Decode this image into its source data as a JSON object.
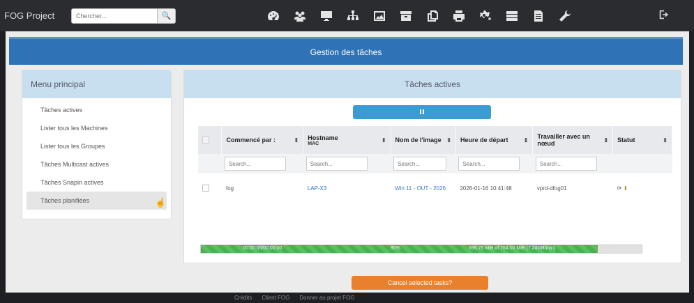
{
  "navbar": {
    "brand": "FOG Project",
    "search_placeholder": "Chercher...",
    "icons": [
      "dashboard-icon",
      "users-icon",
      "monitor-icon",
      "network-icon",
      "image-icon",
      "archive-icon",
      "copy-icon",
      "printer-icon",
      "settings-icon",
      "storage-icon",
      "document-icon",
      "wrench-icon"
    ]
  },
  "page": {
    "title": "Gestion des tâches"
  },
  "sidebar": {
    "title": "Menu principal",
    "items": [
      {
        "label": "Tâches actives"
      },
      {
        "label": "Lister tous les Machines"
      },
      {
        "label": "Lister tous les Groupes"
      },
      {
        "label": "Tâches Multicast actives"
      },
      {
        "label": "Tâches Snapin actives"
      },
      {
        "label": "Tâches planifiées"
      }
    ]
  },
  "panel": {
    "title": "Tâches actives",
    "columns": {
      "started_by": "Commencé par :",
      "hostname": "Hostname",
      "hostname_sub": "MAC",
      "image": "Nom de l'image",
      "start_time": "Heure de départ",
      "node": "Travailler avec un nœud",
      "status": "Statut"
    },
    "filter_placeholder": "Search...",
    "task": {
      "started_by": "fog",
      "hostname": "LAP-X3",
      "image": "Win 11 - OUT - 2026",
      "start_time": "2026-01-16 10:41:48",
      "node": "vprd-dfog01"
    },
    "progress": {
      "fraction": 0.9,
      "elapsed": "00:00:05/00:00:00",
      "percent": "90%",
      "transfer": "696.75 MiB of 764.00 MiB (7.24GB/min)"
    },
    "cancel_label": "Cancel selected tasks?"
  },
  "footer": {
    "status_text": "",
    "links": [
      "Crédits",
      "Client FOG",
      "Donner au projet FOG"
    ]
  },
  "colors": {
    "accent": "#2f72b6",
    "progress": "#4fae53",
    "cancel": "#e8802d",
    "pause": "#3b9bd3"
  }
}
